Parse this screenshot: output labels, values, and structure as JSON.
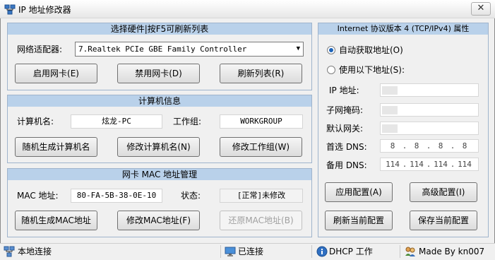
{
  "window": {
    "title": "IP 地址修改器",
    "close_label": "✕"
  },
  "hardware": {
    "header": "选择硬件|按F5可刷新列表",
    "adapter_label": "网络适配器:",
    "adapter_value": "7.Realtek PCIe GBE Family Controller",
    "enable_button": "启用网卡(E)",
    "disable_button": "禁用网卡(D)",
    "refresh_button": "刷新列表(R)"
  },
  "computer": {
    "header": "计算机信息",
    "name_label": "计算机名:",
    "name_value": "炫龙-PC",
    "workgroup_label": "工作组:",
    "workgroup_value": "WORKGROUP",
    "random_name_button": "随机生成计算机名",
    "modify_name_button": "修改计算机名(N)",
    "modify_workgroup_button": "修改工作组(W)"
  },
  "mac": {
    "header": "网卡 MAC 地址管理",
    "mac_label": "MAC 地址:",
    "mac_value": "80-FA-5B-38-0E-10",
    "status_label": "状态:",
    "status_value": "[正常]未修改",
    "random_mac_button": "随机生成MAC地址",
    "modify_mac_button": "修改MAC地址(F)",
    "restore_mac_button": "还原MAC地址(B)"
  },
  "ipv4": {
    "header": "Internet 协议版本 4 (TCP/IPv4) 属性",
    "auto_label": "自动获取地址(O)",
    "manual_label": "使用以下地址(S):",
    "selected": "auto",
    "ip_label": "IP 地址:",
    "mask_label": "子网掩码:",
    "gateway_label": "默认网关:",
    "dns1_label": "首选 DNS:",
    "dns2_label": "备用 DNS:",
    "dns1": [
      "8",
      "8",
      "8",
      "8"
    ],
    "dns2": [
      "114",
      "114",
      "114",
      "114"
    ],
    "apply_button": "应用配置(A)",
    "advanced_button": "高级配置(I)",
    "refresh_button": "刷新当前配置",
    "save_button": "保存当前配置"
  },
  "statusbar": {
    "connection": "本地连接",
    "state": "已连接",
    "dhcp": "DHCP 工作",
    "author": "Made By kn007"
  },
  "colors": {
    "group_header": "#b9d1ea",
    "radio_dot": "#1c63b9"
  },
  "icons": [
    "network-adapter-icon",
    "monitor-icon",
    "info-icon",
    "users-icon"
  ]
}
